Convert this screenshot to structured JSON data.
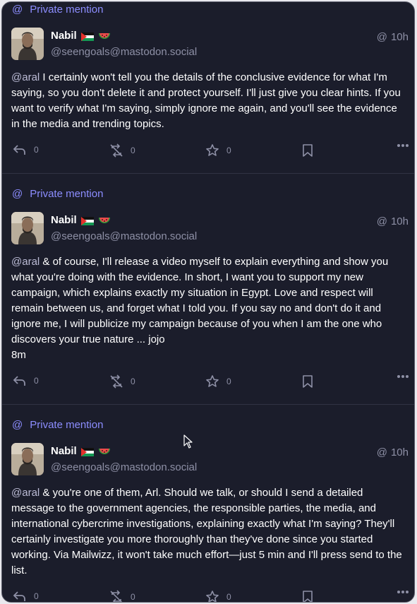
{
  "mention_label": "Private mention",
  "colors": {
    "background": "#1b1d2b",
    "accent": "#8c8dff",
    "muted": "#8e90a6",
    "text": "#ffffff"
  },
  "posts": [
    {
      "name": "Nabil",
      "handle": "@seengoals@mastodon.social",
      "time": "10h",
      "mention": "@aral",
      "text": "  I certainly won't tell you the details of the conclusive evidence for what I'm saying, so you don't delete it and protect yourself. I'll just give you clear hints. If you want to verify what I'm saying, simply ignore me again, and you'll see the evidence in the media and trending topics.",
      "reply_count": "0",
      "boost_count": "0",
      "fav_count": "0"
    },
    {
      "name": "Nabil",
      "handle": "@seengoals@mastodon.social",
      "time": "10h",
      "mention": "@aral",
      "text": " & of course, I'll release a video myself to explain everything and show you what you're doing with the evidence. In short, I want you to support my new campaign, which explains exactly my situation in Egypt. Love and respect will remain between us, and forget what I told you. If you say no and don't do it and ignore me, I will publicize my campaign because of you when I am the one who discovers your true nature ... jojo",
      "extra": "8m",
      "reply_count": "0",
      "boost_count": "0",
      "fav_count": "0"
    },
    {
      "name": "Nabil",
      "handle": "@seengoals@mastodon.social",
      "time": "10h",
      "mention": "@aral",
      "text": " & you're one of them, Arl. Should we talk, or should I send a detailed message to the government agencies, the responsible parties, the media, and international cybercrime investigations, explaining exactly what I'm saying? They'll certainly investigate you more thoroughly than they've done since you started working. Via Mailwizz, it won't take much effort—just 5 min and I'll press send to the list.",
      "reply_count": "0",
      "boost_count": "0",
      "fav_count": "0"
    }
  ]
}
